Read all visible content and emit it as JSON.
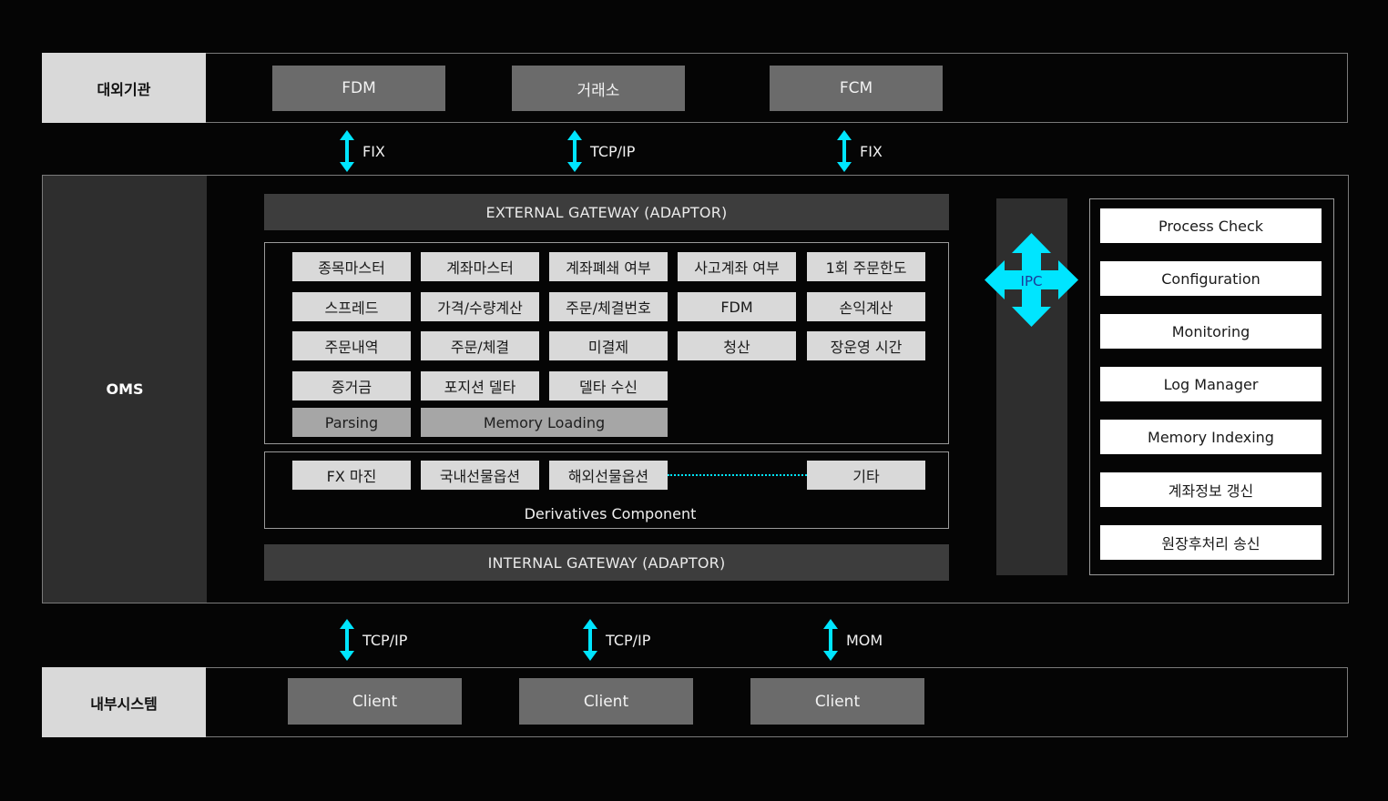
{
  "external": {
    "side_label": "대외기관",
    "boxes": [
      "FDM",
      "거래소",
      "FCM"
    ]
  },
  "external_links": [
    "FIX",
    "TCP/IP",
    "FIX"
  ],
  "oms": {
    "side_label": "OMS",
    "external_gateway": "EXTERNAL GATEWAY (ADAPTOR)",
    "internal_gateway": "INTERNAL GATEWAY (ADAPTOR)",
    "modules": [
      [
        "종목마스터",
        "계좌마스터",
        "계좌폐쇄 여부",
        "사고계좌 여부",
        "1회 주문한도"
      ],
      [
        "스프레드",
        "가격/수량계산",
        "주문/체결번호",
        "FDM",
        "손익계산"
      ],
      [
        "주문내역",
        "주문/체결",
        "미결제",
        "청산",
        "장운영 시간"
      ],
      [
        "증거금",
        "포지션 델타",
        "델타 수신"
      ]
    ],
    "parsing": "Parsing",
    "memory_loading": "Memory Loading",
    "derivatives": {
      "items": [
        "FX 마진",
        "국내선물옵션",
        "해외선물옵션",
        "기타"
      ],
      "label": "Derivatives Component"
    },
    "ipc_label": "IPC",
    "right_panel": [
      "Process Check",
      "Configuration",
      "Monitoring",
      "Log Manager",
      "Memory Indexing",
      "계좌정보 갱신",
      "원장후처리 송신"
    ]
  },
  "internal_links": [
    "TCP/IP",
    "TCP/IP",
    "MOM"
  ],
  "internal": {
    "side_label": "내부시스템",
    "boxes": [
      "Client",
      "Client",
      "Client"
    ]
  },
  "colors": {
    "arrow": "#00e5ff",
    "background": "#050505",
    "panel_dark": "#2e2e2e",
    "chip_light": "#d9d9d9"
  }
}
